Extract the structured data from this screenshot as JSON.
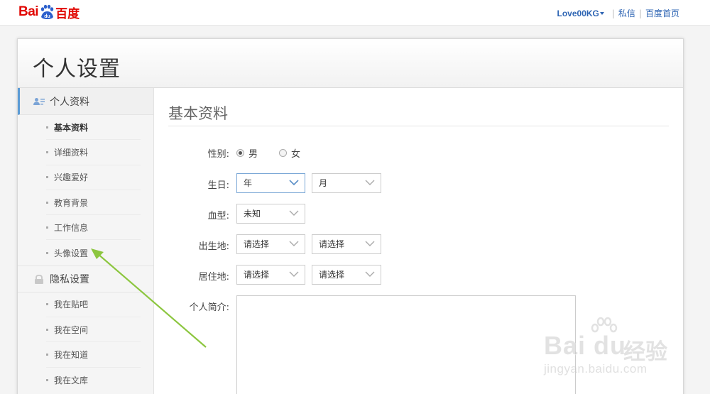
{
  "header": {
    "logo_latin": "Bai",
    "logo_du": "du",
    "logo_cn": "百度",
    "username": "Love00KG",
    "links": [
      "私信",
      "百度首页"
    ]
  },
  "page": {
    "title": "个人设置"
  },
  "sidebar": {
    "groups": [
      {
        "label": "个人资料",
        "icon": "user-card-icon",
        "items": [
          "基本资料",
          "详细资料",
          "兴趣爱好",
          "教育背景",
          "工作信息",
          "头像设置"
        ]
      },
      {
        "label": "隐私设置",
        "icon": "lock-icon",
        "items": [
          "我在贴吧",
          "我在空间",
          "我在知道",
          "我在文库"
        ]
      }
    ],
    "current_item": "基本资料"
  },
  "form": {
    "section_title": "基本资料",
    "gender": {
      "label": "性别:",
      "options": [
        "男",
        "女"
      ],
      "selected": "男"
    },
    "birthday": {
      "label": "生日:",
      "year": "年",
      "month": "月"
    },
    "blood": {
      "label": "血型:",
      "value": "未知"
    },
    "birthplace": {
      "label": "出生地:",
      "province": "请选择",
      "city": "请选择"
    },
    "residence": {
      "label": "居住地:",
      "province": "请选择",
      "city": "请选择"
    },
    "bio": {
      "label": "个人简介:",
      "value": ""
    }
  },
  "watermark": {
    "logo": "Bai du",
    "cn": "经验",
    "url": "jingyan.baidu.com"
  },
  "colors": {
    "brand_red": "#e10601",
    "link_blue": "#2d64b3",
    "annotation_green": "#8cc63f"
  }
}
